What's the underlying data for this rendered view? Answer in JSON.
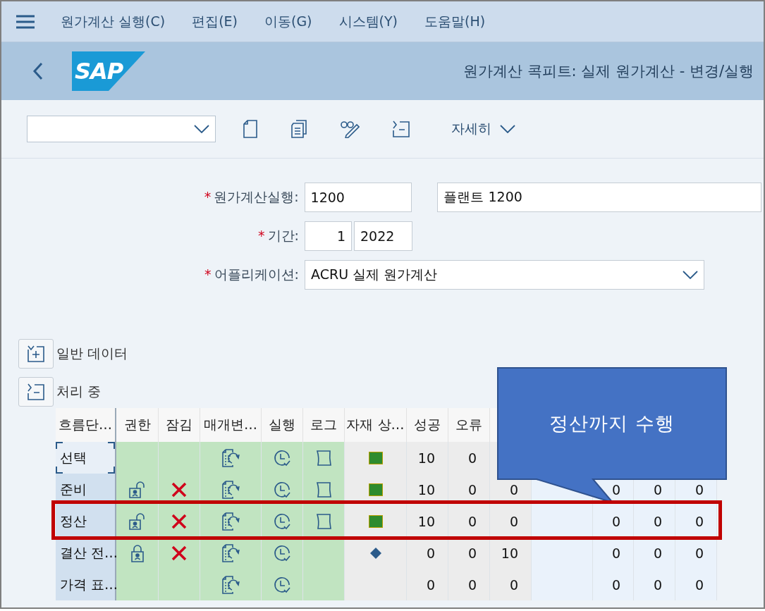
{
  "menu_bar": {
    "items": [
      "원가계산 실행(C)",
      "편집(E)",
      "이동(G)",
      "시스템(Y)",
      "도움말(H)"
    ]
  },
  "header": {
    "logo": "SAP",
    "title": "원가계산 콕피트: 실제 원가계산 - 변경/실행"
  },
  "toolbar": {
    "more": "자세히"
  },
  "form": {
    "fields": [
      {
        "kind": "costing_run",
        "marker": "*",
        "label": "원가계산실행:",
        "value": "1200",
        "description": "플랜트 1200"
      },
      {
        "kind": "period",
        "marker": "*",
        "label": "기간:",
        "period": "1",
        "year": "2022"
      },
      {
        "kind": "dropdown",
        "marker": "*",
        "label": "어플리케이션:",
        "value": "ACRU 실제 원가계산"
      }
    ]
  },
  "sections": [
    {
      "title": "일반 데이터",
      "expanded": false
    },
    {
      "title": "처리 중",
      "expanded": true
    }
  ],
  "table": {
    "columns": [
      "흐름단…",
      "권한",
      "잠김",
      "매개변…",
      "실행",
      "로그",
      "자재 상…",
      "성공",
      "오류"
    ],
    "rows": [
      {
        "step": "선택",
        "selected": true,
        "unlocked": false,
        "locked": false,
        "lock": false,
        "parameters": true,
        "execute": true,
        "log": true,
        "status_ok": true,
        "status_pending": false,
        "counts": [
          "10",
          "0"
        ]
      },
      {
        "step": "준비",
        "selected": false,
        "unlocked": true,
        "locked": false,
        "lock": true,
        "parameters": true,
        "execute": true,
        "log": true,
        "status_ok": true,
        "status_pending": false,
        "counts": [
          "10",
          "0",
          "0"
        ],
        "totals": [
          "0",
          "0",
          "0"
        ]
      },
      {
        "step": "정산",
        "selected": false,
        "highlighted": true,
        "unlocked": true,
        "locked": false,
        "lock": true,
        "parameters": true,
        "execute": true,
        "log": true,
        "status_ok": true,
        "status_pending": false,
        "counts": [
          "10",
          "0",
          "0"
        ],
        "totals": [
          "0",
          "0",
          "0"
        ]
      },
      {
        "step": "결산 전…",
        "selected": false,
        "unlocked": false,
        "locked": true,
        "lock": true,
        "parameters": true,
        "execute": true,
        "log": false,
        "status_ok": false,
        "status_pending": true,
        "counts": [
          "0",
          "0",
          "10"
        ],
        "totals": [
          "0",
          "0",
          "0"
        ]
      },
      {
        "step": "가격 표…",
        "selected": false,
        "unlocked": false,
        "locked": false,
        "lock": false,
        "parameters": true,
        "execute": true,
        "log": false,
        "status_ok": false,
        "status_pending": false,
        "counts": [
          "0",
          "0",
          "0"
        ],
        "totals": [
          "0",
          "0",
          "0"
        ]
      }
    ]
  },
  "callout": {
    "text": "정산까지 수행"
  }
}
